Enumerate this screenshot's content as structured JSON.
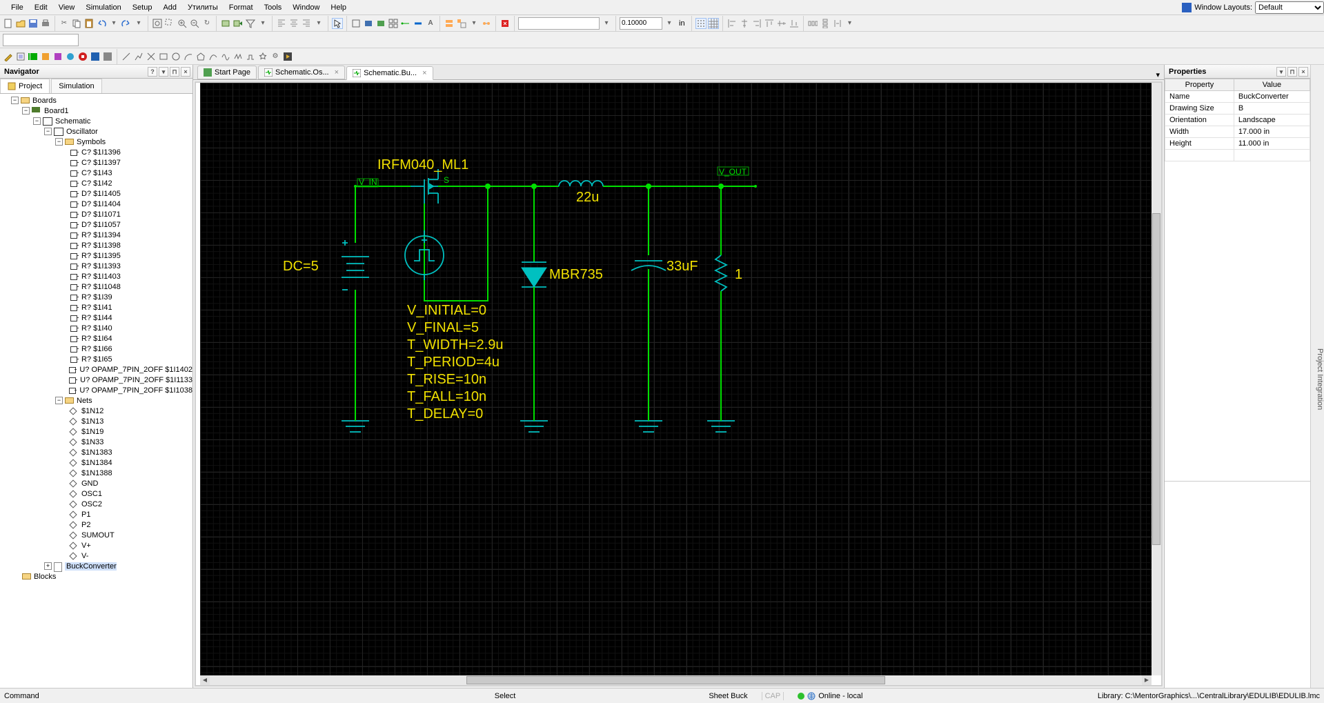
{
  "menu": {
    "items": [
      "File",
      "Edit",
      "View",
      "Simulation",
      "Setup",
      "Add",
      "Утилиты",
      "Format",
      "Tools",
      "Window",
      "Help"
    ],
    "winlayout_label": "Window Layouts:",
    "winlayout_value": "Default"
  },
  "toolbar2": {
    "grid_value": "0.10000",
    "unit": "in"
  },
  "nav": {
    "title": "Navigator",
    "tabs": [
      "Project",
      "Simulation"
    ],
    "root": "Boards",
    "board": "Board1",
    "schematic": "Schematic",
    "oscillator": "Oscillator",
    "symbols_label": "Symbols",
    "symbols": [
      "C? $1I1396",
      "C? $1I1397",
      "C? $1I43",
      "C? $1I42",
      "D? $1I1405",
      "D? $1I1404",
      "D? $1I1071",
      "D? $1I1057",
      "R? $1I1394",
      "R? $1I1398",
      "R? $1I1395",
      "R? $1I1393",
      "R? $1I1403",
      "R? $1I1048",
      "R? $1I39",
      "R? $1I41",
      "R? $1I44",
      "R? $1I40",
      "R? $1I64",
      "R? $1I66",
      "R? $1I65",
      "U? OPAMP_7PIN_2OFF $1I1402",
      "U? OPAMP_7PIN_2OFF $1I1133",
      "U? OPAMP_7PIN_2OFF $1I1038"
    ],
    "nets_label": "Nets",
    "nets": [
      "$1N12",
      "$1N13",
      "$1N19",
      "$1N33",
      "$1N1383",
      "$1N1384",
      "$1N1388",
      "GND",
      "OSC1",
      "OSC2",
      "P1",
      "P2",
      "SUMOUT",
      "V+",
      "V-"
    ],
    "buck": "BuckConverter",
    "blocks": "Blocks"
  },
  "tabs": [
    {
      "label": "Start Page",
      "close": false
    },
    {
      "label": "Schematic.Os...",
      "close": true
    },
    {
      "label": "Schematic.Bu...",
      "close": true,
      "active": true
    }
  ],
  "sch": {
    "mosfet": "IRFM040_ML1",
    "vin": "V_IN",
    "vout": "V_OUT",
    "inductor": "22u",
    "capval": "33uF",
    "resval": "1",
    "dc": "DC=5",
    "diode": "MBR735",
    "pulse": [
      "V_INITIAL=0",
      "V_FINAL=5",
      "T_WIDTH=2.9u",
      "T_PERIOD=4u",
      "T_RISE=10n",
      "T_FALL=10n",
      "T_DELAY=0"
    ]
  },
  "props": {
    "title": "Properties",
    "cols": [
      "Property",
      "Value"
    ],
    "rows": [
      [
        "Name",
        "BuckConverter"
      ],
      [
        "Drawing Size",
        "B"
      ],
      [
        "Orientation",
        "Landscape"
      ],
      [
        "Width",
        "17.000 in"
      ],
      [
        "Height",
        "11.000 in"
      ]
    ]
  },
  "status": {
    "command": "Command",
    "mode": "Select",
    "sheet": "Sheet Buck",
    "cap": "CAP",
    "online": "Online - local",
    "library": "Library: C:\\MentorGraphics\\...\\CentralLibrary\\EDULIB\\EDULIB.lmc"
  },
  "sidetab": "Project Integration"
}
